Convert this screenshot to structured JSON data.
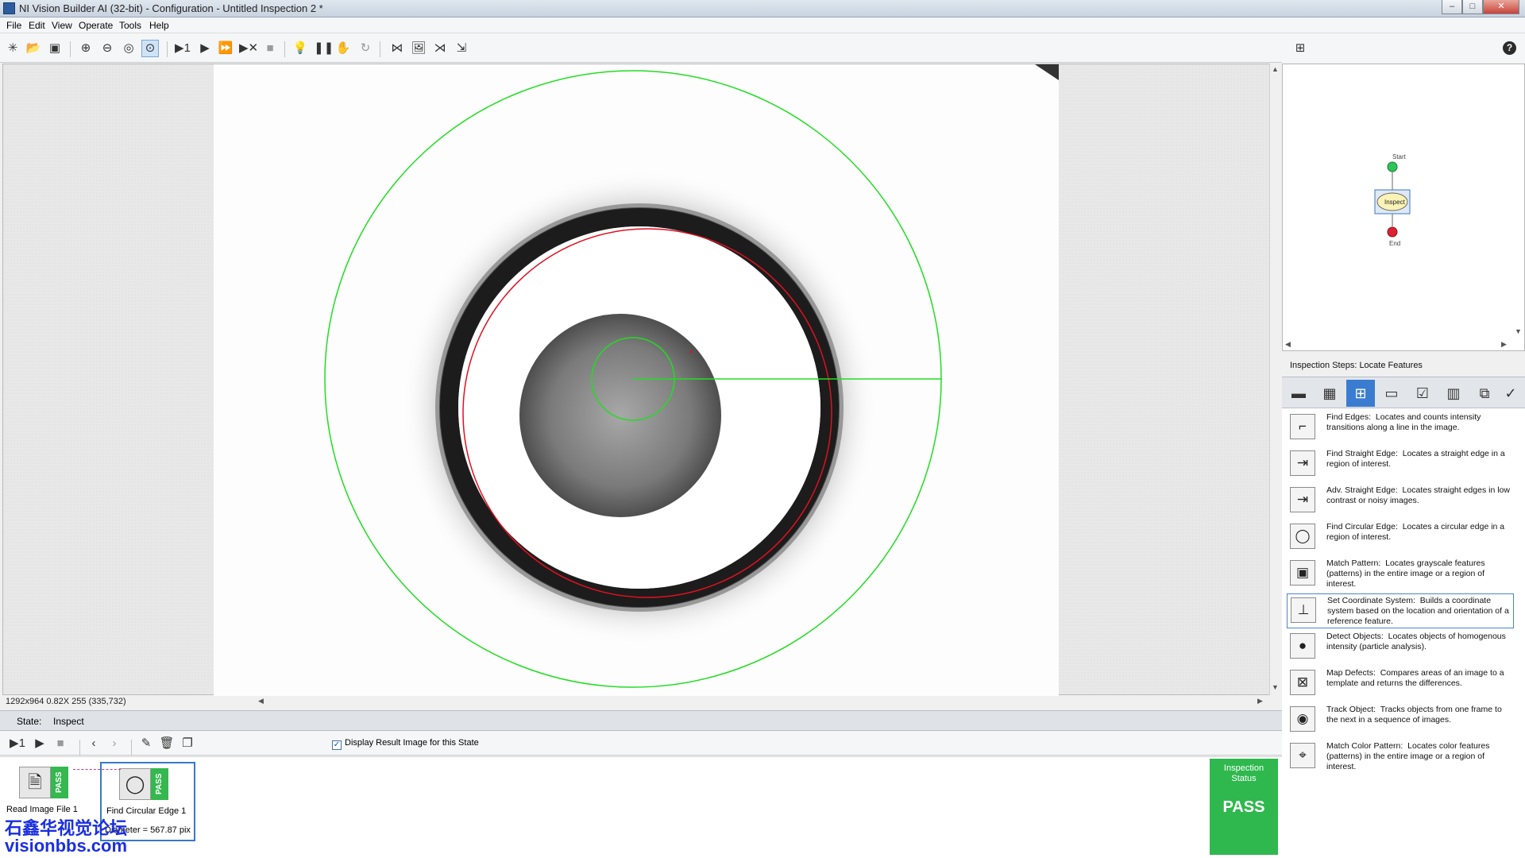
{
  "window": {
    "title": "NI Vision Builder AI (32-bit) - Configuration - Untitled Inspection 2 *",
    "minimize": "–",
    "maximize": "□",
    "close": "✕"
  },
  "menu": [
    "File",
    "Edit",
    "View",
    "Operate",
    "Tools",
    "Help"
  ],
  "toolbar": {
    "icons": [
      "new-icon",
      "open-icon",
      "save-icon",
      "zoom-in-icon",
      "zoom-out-icon",
      "zoom-fit-icon",
      "zoom-actual-icon",
      "step-icon",
      "run-icon",
      "run-continuous-icon",
      "run-to-end-icon",
      "stop-icon",
      "bulb-icon",
      "pause-icon",
      "hand-icon",
      "refresh-icon",
      "image-compare-icon",
      "image-icon",
      "overlay-icon",
      "export-icon"
    ]
  },
  "viewer": {
    "status_text": "1292x964 0.82X 255    (335,732)"
  },
  "state": {
    "label": "State:",
    "value": "Inspect",
    "display_result_label": "Display Result Image for this State",
    "display_result_checked": true
  },
  "steps": [
    {
      "name": "Read Image File 1",
      "result": "",
      "status": "PASS",
      "icon": "read-image-icon"
    },
    {
      "name": "Find Circular Edge 1",
      "result": "Diameter = 567.87 pix",
      "status": "PASS",
      "icon": "circle-edge-icon"
    }
  ],
  "inspection_status": {
    "caption_line1": "Inspection",
    "caption_line2": "Status",
    "value": "PASS",
    "color": "#2fb84e"
  },
  "watermark": {
    "line1": "石鑫华视觉论坛",
    "line2": "visionbbs.com"
  },
  "flow": {
    "start_label": "Start",
    "state_label": "Inspect",
    "end_label": "End"
  },
  "palette": {
    "header": "Inspection Steps: Locate Features",
    "tabs": [
      "acquire-tab-icon",
      "enhance-tab-icon",
      "locate-tab-icon",
      "measure-tab-icon",
      "check-tab-icon",
      "identify-tab-icon",
      "communicate-tab-icon",
      "tools-tab-icon"
    ],
    "active_tab": 2,
    "items": [
      {
        "title": "Find Edges:",
        "desc": "Locates and counts intensity transitions along a line in the image.",
        "icon": "find-edges-icon"
      },
      {
        "title": "Find Straight Edge:",
        "desc": "Locates a straight edge in a region of interest.",
        "icon": "straight-edge-icon"
      },
      {
        "title": "Adv. Straight Edge:",
        "desc": "Locates straight edges in low contrast or noisy images.",
        "icon": "adv-straight-edge-icon"
      },
      {
        "title": "Find Circular Edge:",
        "desc": "Locates a circular edge in a region of interest.",
        "icon": "circular-edge-icon"
      },
      {
        "title": "Match Pattern:",
        "desc": "Locates grayscale features (patterns) in the entire image or a region of interest.",
        "icon": "match-pattern-icon"
      },
      {
        "title": "Set Coordinate System:",
        "desc": "Builds a coordinate system based on the location and orientation of a reference feature.",
        "icon": "coordinate-system-icon"
      },
      {
        "title": "Detect Objects:",
        "desc": "Locates objects of homogenous intensity (particle analysis).",
        "icon": "detect-objects-icon"
      },
      {
        "title": "Map Defects:",
        "desc": "Compares areas of an image to a template and returns the differences.",
        "icon": "map-defects-icon"
      },
      {
        "title": "Track Object:",
        "desc": "Tracks objects from one frame to the next in a sequence of images.",
        "icon": "track-object-icon"
      },
      {
        "title": "Match Color Pattern:",
        "desc": "Locates color features (patterns) in the entire image or a region of interest.",
        "icon": "color-pattern-icon"
      }
    ],
    "selected_item": 5
  },
  "colors": {
    "roi_outer": "#22dd22",
    "detected_edge": "#e01020",
    "pass_green": "#2fb84e",
    "accent_blue": "#3a7dd0"
  }
}
